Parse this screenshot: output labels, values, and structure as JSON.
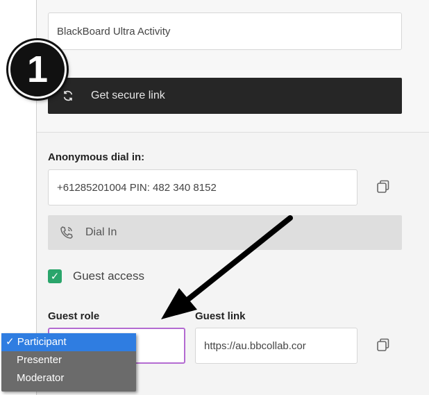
{
  "session": {
    "name_value": "BlackBoard Ultra Activity",
    "secure_link_label": "Get secure link"
  },
  "dial_in": {
    "label": "Anonymous dial in:",
    "number": "+61285201004 PIN: 482 340 8152",
    "button_label": "Dial In"
  },
  "guest": {
    "access_label": "Guest access",
    "access_checked": true,
    "role_label": "Guest role",
    "link_label": "Guest link",
    "link_value": "https://au.bbcollab.cor"
  },
  "role_dropdown": {
    "options": [
      "✓ Participant",
      "Presenter",
      "Moderator"
    ],
    "selected": "Participant"
  },
  "annotation": {
    "step_number": "1"
  },
  "colors": {
    "accent_green": "#2aa56b",
    "selected_blue": "#2f7de1",
    "focus_purple": "#b36ad1",
    "dark_button": "#262626"
  }
}
